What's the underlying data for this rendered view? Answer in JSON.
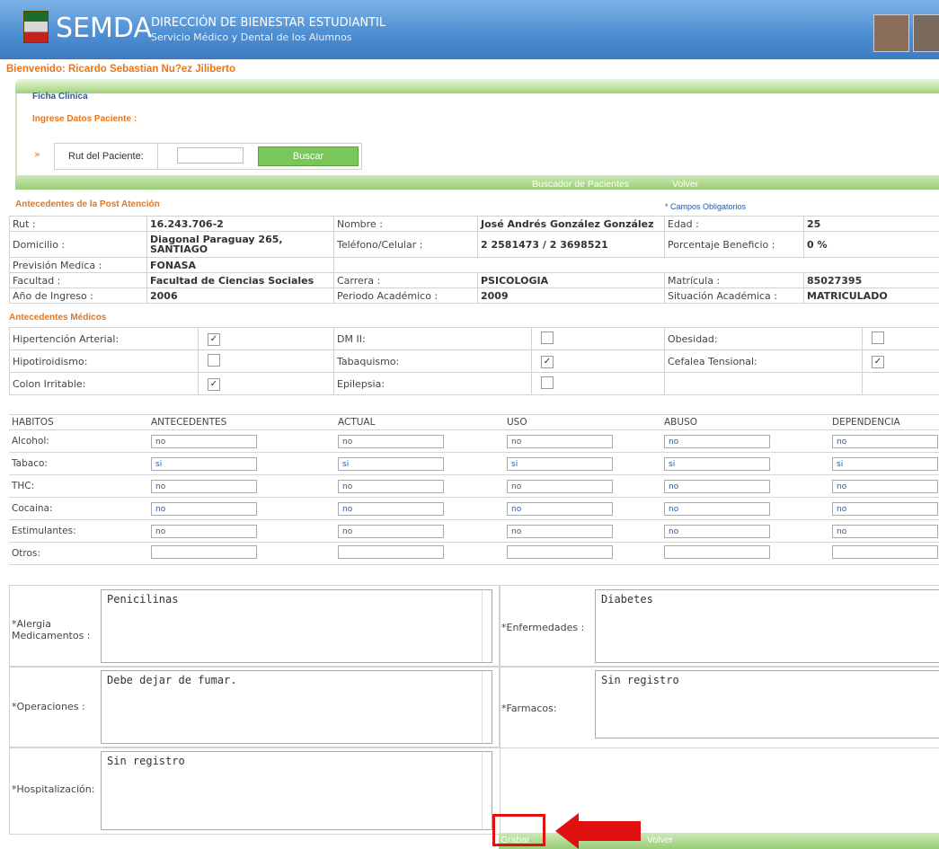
{
  "header": {
    "logo_text": "SEMDA",
    "subtitle_line1": "DIRECCIÓN DE BIENESTAR ESTUDIANTIL",
    "subtitle_line2": "Servicio Médico y Dental de los Alumnos"
  },
  "welcome": "Bienvenido: Ricardo Sebastian Nu?ez Jiliberto",
  "ficha": {
    "title": "Ficha Clinica",
    "ingrese": "Ingrese Datos Paciente :",
    "arrows": "»",
    "rut_label": "Rut del Paciente:",
    "buscar": "Buscar",
    "nav_buscador": "Buscador de Pacientes",
    "nav_volver": "Volver"
  },
  "post": {
    "title": "Antecedentes de la Post Atención",
    "obligatorios": "* Campos Obligatorios",
    "rows": [
      [
        "Rut :",
        "16.243.706-2",
        "Nombre :",
        "José Andrés González González",
        "Edad :",
        "25"
      ],
      [
        "Domicilio :",
        "Diagonal Paraguay 265, SANTIAGO",
        "Teléfono/Celular :",
        "2 2581473 / 2 3698521",
        "Porcentaje Beneficio :",
        "0 %"
      ],
      [
        "Previsión Medica :",
        "FONASA",
        "",
        "",
        "",
        ""
      ],
      [
        "Facultad :",
        "Facultad de Ciencias Sociales",
        "Carrera :",
        "PSICOLOGIA",
        "Matrícula :",
        "85027395"
      ],
      [
        "Año de Ingreso :",
        "2006",
        "Periodo Académico :",
        "2009",
        "Situación Académica :",
        "MATRICULADO"
      ]
    ]
  },
  "medical": {
    "title": "Antecedentes Médicos",
    "rows": [
      [
        {
          "label": "Hipertención Arterial:",
          "checked": true
        },
        {
          "label": "DM II:",
          "checked": false
        },
        {
          "label": "Obesidad:",
          "checked": false
        }
      ],
      [
        {
          "label": "Hipotiroidismo:",
          "checked": false
        },
        {
          "label": "Tabaquismo:",
          "checked": true
        },
        {
          "label": "Cefalea Tensional:",
          "checked": true
        }
      ],
      [
        {
          "label": "Colon Irritable:",
          "checked": true
        },
        {
          "label": "Epilepsia:",
          "checked": false
        },
        null
      ]
    ]
  },
  "habitos": {
    "headers": [
      "HABITOS",
      "ANTECEDENTES",
      "ACTUAL",
      "USO",
      "ABUSO",
      "DEPENDENCIA"
    ],
    "rows": [
      [
        "Alcohol:",
        "no",
        "no",
        "no",
        "no",
        "no"
      ],
      [
        "Tabaco:",
        "si",
        "si",
        "si",
        "si",
        "si"
      ],
      [
        "THC:",
        "no",
        "no",
        "no",
        "no",
        "no"
      ],
      [
        "Cocaina:",
        "no",
        "no",
        "no",
        "no",
        "no"
      ],
      [
        "Estimulantes:",
        "no",
        "no",
        "no",
        "no",
        "no"
      ],
      [
        "Otros:",
        "",
        "",
        "",
        "",
        ""
      ]
    ]
  },
  "texts": {
    "alergia_label": "*Alergia Medicamentos :",
    "alergia_value": "Penicilinas",
    "enfermedades_label": "*Enfermedades :",
    "enfermedades_value": "Diabetes",
    "operaciones_label": "*Operaciones :",
    "operaciones_value": "Debe dejar de fumar.",
    "farmacos_label": "*Farmacos:",
    "farmacos_value": "Sin registro",
    "hospitalizacion_label": "*Hospitalización:",
    "hospitalizacion_value": "Sin registro"
  },
  "footer": {
    "grabar": "Grabar",
    "volver": "Volver"
  }
}
